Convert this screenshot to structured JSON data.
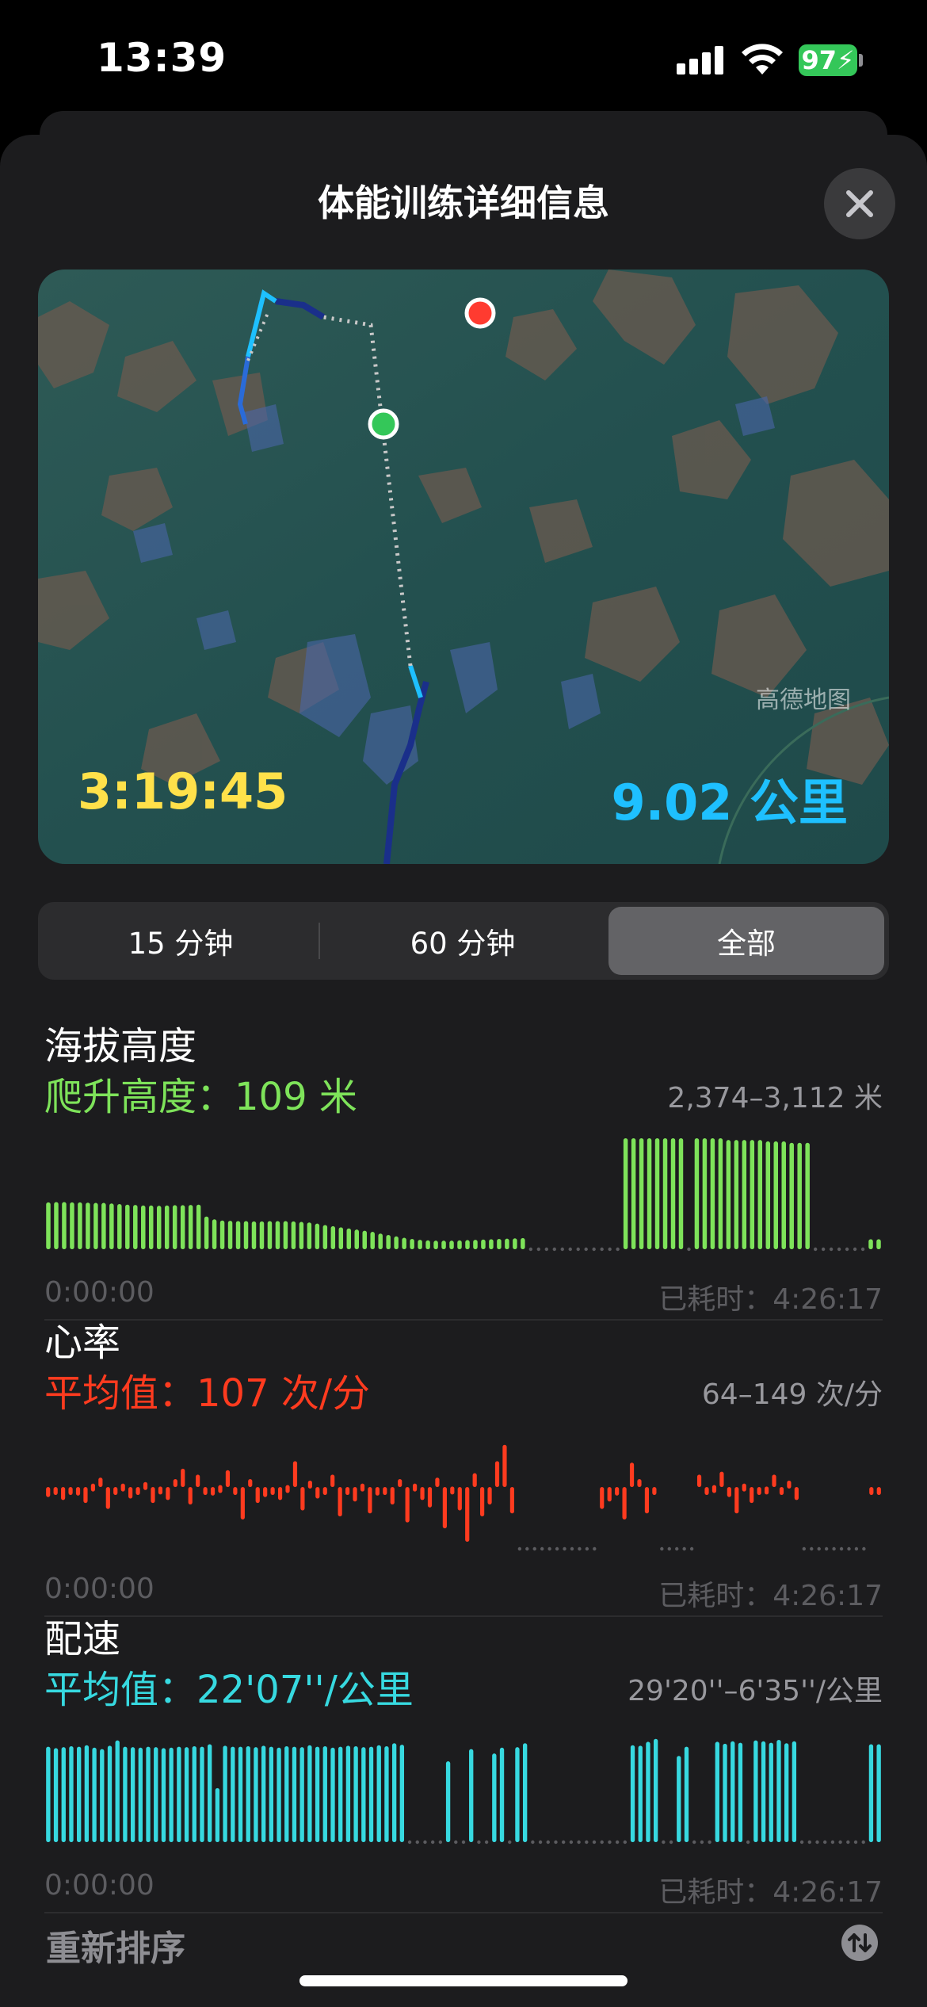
{
  "status_bar": {
    "time": "13:39",
    "battery": "97"
  },
  "sheet": {
    "title": "体能训练详细信息"
  },
  "map": {
    "duration": "3:19:45",
    "distance": "9.02 公里",
    "watermark": "高德地图",
    "colors": {
      "duration": "#ffe14a",
      "distance": "#1ec0ff",
      "start_marker": "#34c759",
      "end_marker": "#ff3b30",
      "route": "#1ec0ff"
    }
  },
  "segmented": {
    "options": [
      "15 分钟",
      "60 分钟",
      "全部"
    ],
    "selected": "全部"
  },
  "metrics": [
    {
      "title": "海拔高度",
      "summary": "爬升高度：109 米",
      "range": "2,374–3,112 米",
      "axis_start": "0:00:00",
      "axis_end": "已耗时：4:26:17",
      "color": "#7ee35a"
    },
    {
      "title": "心率",
      "summary": "平均值：107 次/分",
      "range": "64–149 次/分",
      "axis_start": "0:00:00",
      "axis_end": "已耗时：4:26:17",
      "color": "#ff3b1f"
    },
    {
      "title": "配速",
      "summary": "平均值：22'07''/公里",
      "range": "29'20''–6'35''/公里",
      "axis_start": "0:00:00",
      "axis_end": "已耗时：4:26:17",
      "color": "#37d9e0"
    }
  ],
  "reorder": {
    "label": "重新排序"
  },
  "chart_data": [
    {
      "type": "bar",
      "title": "海拔高度",
      "x": [
        "0:00:00",
        "4:26:17"
      ],
      "ylim": [
        2374,
        3112
      ],
      "values": [
        2660,
        2662,
        2662,
        2660,
        2660,
        2658,
        2656,
        2656,
        2652,
        2648,
        2644,
        2642,
        2638,
        2638,
        2636,
        2638,
        2640,
        2640,
        2642,
        2644,
        2560,
        2540,
        2532,
        2530,
        2528,
        2528,
        2526,
        2526,
        2528,
        2528,
        2528,
        2526,
        2522,
        2518,
        2510,
        2500,
        2492,
        2484,
        2476,
        2468,
        2460,
        2452,
        2440,
        2430,
        2420,
        2410,
        2402,
        2396,
        2392,
        2390,
        2390,
        2390,
        2392,
        2394,
        2396,
        2398,
        2400,
        2402,
        2404,
        2406,
        2408,
        null,
        null,
        null,
        null,
        null,
        null,
        null,
        null,
        null,
        null,
        null,
        null,
        3112,
        3112,
        3112,
        3112,
        3112,
        3112,
        3112,
        3112,
        null,
        3112,
        3112,
        3112,
        3112,
        3100,
        3100,
        3100,
        3100,
        3100,
        3090,
        3090,
        3090,
        3080,
        3080,
        3080,
        null,
        null,
        null,
        null,
        null,
        null,
        null,
        2400,
        2400
      ]
    },
    {
      "type": "bar",
      "title": "心率",
      "x": [
        "0:00:00",
        "4:26:17"
      ],
      "ylim": [
        64,
        149
      ],
      "values": [
        103,
        108,
        101,
        109,
        104,
        99,
        112,
        116,
        95,
        106,
        112,
        102,
        107,
        113,
        99,
        110,
        101,
        115,
        122,
        98,
        118,
        107,
        104,
        111,
        121,
        106,
        88,
        115,
        99,
        103,
        109,
        101,
        111,
        127,
        94,
        114,
        102,
        105,
        118,
        90,
        108,
        100,
        112,
        92,
        104,
        109,
        98,
        115,
        86,
        112,
        101,
        96,
        116,
        82,
        110,
        94,
        73,
        119,
        90,
        98,
        127,
        138,
        92,
        null,
        null,
        null,
        null,
        null,
        null,
        null,
        null,
        null,
        null,
        null,
        95,
        100,
        104,
        88,
        126,
        115,
        92,
        107,
        null,
        null,
        null,
        null,
        null,
        118,
        106,
        111,
        120,
        103,
        92,
        112,
        99,
        105,
        110,
        118,
        108,
        114,
        101,
        null,
        null,
        null,
        null,
        null,
        null,
        null,
        null,
        null,
        106,
        109
      ]
    },
    {
      "type": "bar",
      "title": "配速",
      "x": [
        "0:00:00",
        "4:26:17"
      ],
      "ylim": [
        29.33,
        6.58
      ],
      "values": [
        25.5,
        25.2,
        25.4,
        25.6,
        25.5,
        25.8,
        25.3,
        25.0,
        25.7,
        26.8,
        25.5,
        25.4,
        25.3,
        25.5,
        25.4,
        25.2,
        25.3,
        25.5,
        25.4,
        25.6,
        25.5,
        26.0,
        17.0,
        25.7,
        25.5,
        25.5,
        25.6,
        25.4,
        25.7,
        25.5,
        25.3,
        25.6,
        25.5,
        25.4,
        25.8,
        25.5,
        25.6,
        25.3,
        25.5,
        25.7,
        25.6,
        25.4,
        25.5,
        25.8,
        25.6,
        26.2,
        25.9,
        null,
        null,
        null,
        null,
        null,
        22.5,
        null,
        null,
        25.0,
        null,
        null,
        24.1,
        25.3,
        null,
        25.4,
        26.2,
        null,
        null,
        null,
        null,
        null,
        null,
        null,
        null,
        null,
        null,
        null,
        null,
        null,
        25.8,
        25.7,
        26.5,
        27.1,
        null,
        null,
        23.6,
        25.5,
        null,
        null,
        null,
        26.5,
        26.1,
        26.6,
        26.3,
        null,
        26.8,
        26.6,
        26.3,
        26.9,
        26.2,
        26.6,
        null,
        null,
        null,
        null,
        null,
        null,
        null,
        null,
        null,
        26.0,
        26.0
      ]
    }
  ]
}
